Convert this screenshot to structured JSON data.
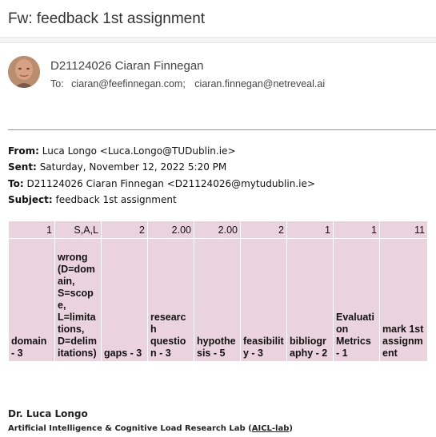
{
  "email": {
    "subject": "Fw: feedback 1st assignment",
    "sender": "D21124026 Ciaran Finnegan",
    "to_label": "To:",
    "recipients": [
      "ciaran@feefinnegan.com;",
      "ciaran.finnegan@netreveal.ai"
    ]
  },
  "forwarded": {
    "from_label": "From:",
    "from_value": "Luca Longo <Luca.Longo@TUDublin.ie>",
    "sent_label": "Sent:",
    "sent_value": "Saturday, November 12, 2022 5:20 PM",
    "to_label": "To:",
    "to_value": "D21124026 Ciaran Finnegan <D21124026@mytudublin.ie>",
    "subject_label": "Subject:",
    "subject_value": "feedback 1st assignment"
  },
  "grades_table": {
    "values": [
      "1",
      "S,A,L",
      "2",
      "2.00",
      "2.00",
      "2",
      "1",
      "1",
      "11"
    ],
    "headers": [
      "domain - 3",
      "wrong (D=domain, S=scope, L=limitations, D=delimitations)",
      "gaps - 3",
      "research question - 3",
      "hypothesis - 5",
      "feasibility - 3",
      "bibliography - 2",
      "Evaluation Metrics - 1",
      "mark 1st assignment"
    ],
    "cell_color": "#ead3dd"
  },
  "signature": {
    "name": "Dr. Luca Longo",
    "lab_text": "Artificial Intelligence & Cognitive Load Research Lab (",
    "lab_link": "AICL-lab",
    "lab_close": ")"
  }
}
